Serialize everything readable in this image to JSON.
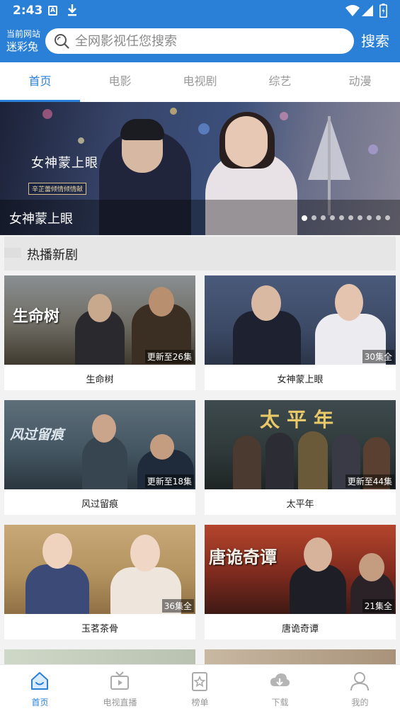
{
  "status_bar": {
    "time": "2:43",
    "notif_badge": "A"
  },
  "header": {
    "site_label": "当前网站",
    "site_name": "迷彩兔",
    "search_placeholder": "全网影视任您搜索",
    "search_button": "搜索",
    "accent_color": "#2a7fd6"
  },
  "tabs": [
    {
      "label": "首页",
      "active": true
    },
    {
      "label": "电影",
      "active": false
    },
    {
      "label": "电视剧",
      "active": false
    },
    {
      "label": "综艺",
      "active": false
    },
    {
      "label": "动漫",
      "active": false
    }
  ],
  "banner": {
    "title": "女神蒙上眼",
    "logo_text": "女神蒙上眼",
    "logo_tag": "辛芷蕾倾情倾情献",
    "dots_total": 10,
    "dot_active": 0
  },
  "section": {
    "title": "热播新剧"
  },
  "shows": [
    {
      "name": "生命树",
      "badge": "更新至26集",
      "poster_title": "生命树"
    },
    {
      "name": "女神蒙上眼",
      "badge": "30集全",
      "poster_title": ""
    },
    {
      "name": "风过留痕",
      "badge": "更新至18集",
      "poster_title": "风过留痕"
    },
    {
      "name": "太平年",
      "badge": "更新至44集",
      "poster_title": "太平年"
    },
    {
      "name": "玉茗茶骨",
      "badge": "36集全",
      "poster_title": ""
    },
    {
      "name": "唐诡奇谭",
      "badge": "21集全",
      "poster_title": "唐诡奇谭"
    }
  ],
  "bottom_nav": [
    {
      "label": "首页",
      "icon": "home-icon",
      "active": true
    },
    {
      "label": "电视直播",
      "icon": "tv-icon",
      "active": false
    },
    {
      "label": "榜单",
      "icon": "ranking-icon",
      "active": false
    },
    {
      "label": "下载",
      "icon": "cloud-download-icon",
      "active": false
    },
    {
      "label": "我的",
      "icon": "user-icon",
      "active": false
    }
  ]
}
